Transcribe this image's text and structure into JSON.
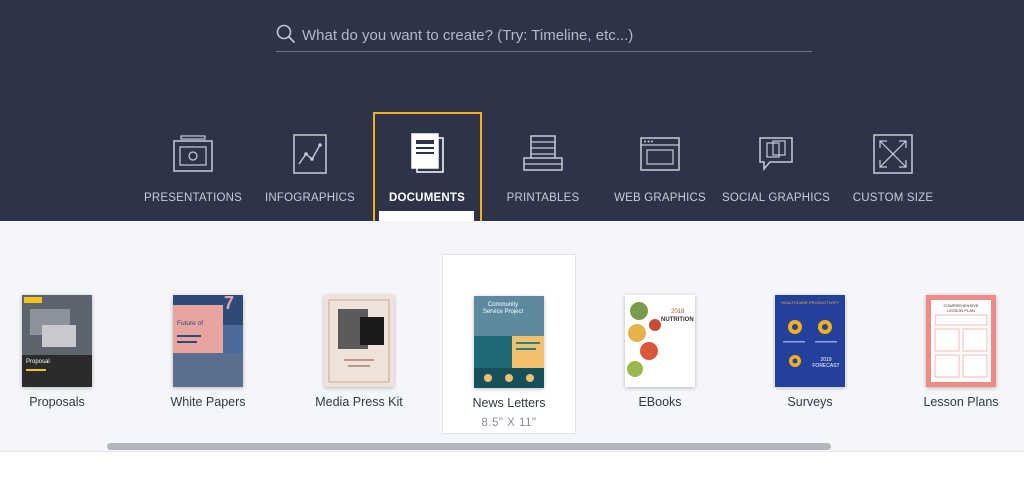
{
  "search": {
    "placeholder": "What do you want to create? (Try: Timeline, etc...)"
  },
  "categories": [
    {
      "label": "PRESENTATIONS",
      "icon": "presentation-icon"
    },
    {
      "label": "INFOGRAPHICS",
      "icon": "infographic-icon"
    },
    {
      "label": "DOCUMENTS",
      "icon": "document-icon",
      "active": true
    },
    {
      "label": "PRINTABLES",
      "icon": "printable-icon"
    },
    {
      "label": "WEB GRAPHICS",
      "icon": "web-graphic-icon"
    },
    {
      "label": "SOCIAL GRAPHICS",
      "icon": "social-graphic-icon"
    },
    {
      "label": "CUSTOM SIZE",
      "icon": "custom-size-icon"
    }
  ],
  "documents": [
    {
      "label": "Proposals"
    },
    {
      "label": "White Papers"
    },
    {
      "label": "Media Press Kit"
    },
    {
      "label": "News Letters",
      "size": "8.5\" X 11\"",
      "selected": true
    },
    {
      "label": "EBooks"
    },
    {
      "label": "Surveys"
    },
    {
      "label": "Lesson Plans"
    }
  ],
  "thumb_text": {
    "proposal": "Proposal",
    "white_paper": "Future of",
    "white_paper_number": "7",
    "newsletter": "Community Service Project",
    "ebook_year": "2018",
    "ebook_title": "NUTRITION",
    "survey_header": "HEALTHCARE PRODUCTIVITY",
    "survey_title": "2019 FORECAST",
    "lesson_header": "COMPREHENSIVE LESSON PLAN"
  },
  "colors": {
    "header_bg": "#2d3448",
    "active_outline": "#f2b01e",
    "panel_bg": "#f5f6f9"
  }
}
